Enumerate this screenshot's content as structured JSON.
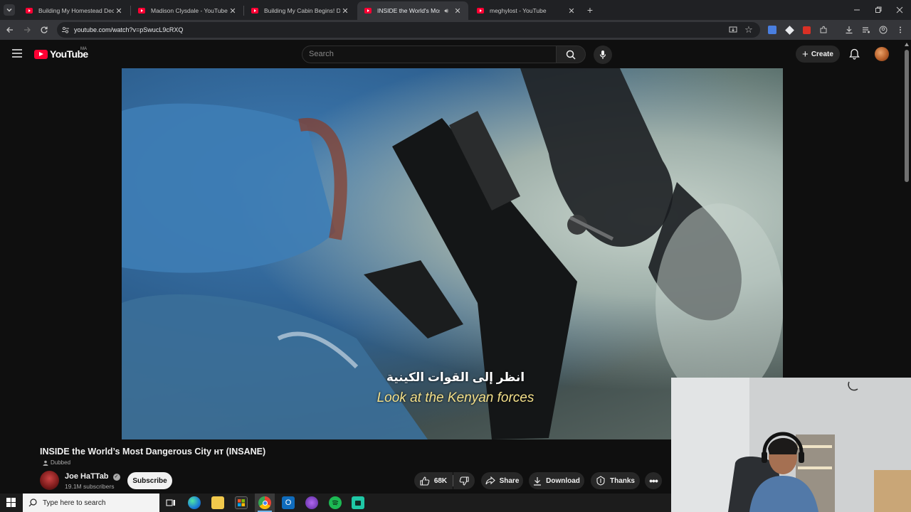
{
  "browser": {
    "tabs": [
      {
        "title": "Building My Homestead Deck D",
        "active": false
      },
      {
        "title": "Madison Clysdale - YouTube",
        "active": false
      },
      {
        "title": "Building My Cabin Begins! Dig",
        "active": false
      },
      {
        "title": "INSIDE the World's Most Da",
        "active": true
      },
      {
        "title": "meghylost - YouTube",
        "active": false
      }
    ],
    "url": "youtube.com/watch?v=pSwucL9cRXQ"
  },
  "youtube": {
    "logo": "YouTube",
    "region": "MA",
    "search_placeholder": "Search",
    "create_label": "Create"
  },
  "video": {
    "subtitle_arabic": "انظر إلى القوات الكينية",
    "subtitle_english": "Look at the Kenyan forces",
    "title": "INSIDE the World’s Most Dangerous City ʜᴛ (INSANE)",
    "dubbed_label": "Dubbed",
    "channel_name": "Joe HaTTab",
    "subscribers": "19.1M subscribers",
    "subscribe_label": "Subscribe",
    "likes": "68K",
    "share_label": "Share",
    "download_label": "Download",
    "thanks_label": "Thanks"
  },
  "taskbar": {
    "search_placeholder": "Type here to search"
  },
  "colors": {
    "youtube_red": "#ff0033",
    "background": "#0f0f0f",
    "subtitle_yellow": "#f4e08a"
  }
}
